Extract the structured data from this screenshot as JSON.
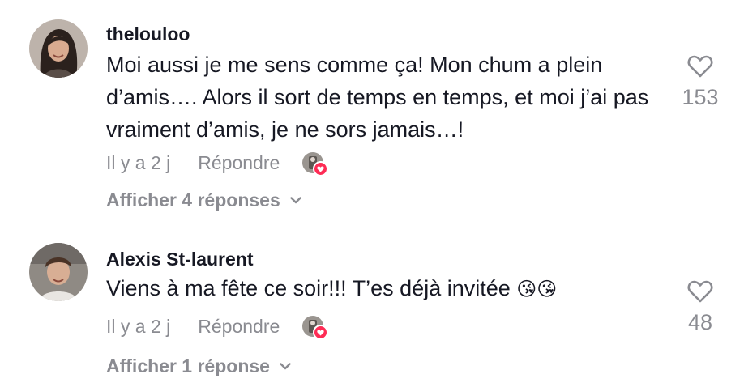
{
  "comments": [
    {
      "username": "thelouloo",
      "text": "Moi aussi je me sens comme ça! Mon chum a plein d’amis…. Alors il sort de temps en temps, et moi j’ai pas vraiment d’amis, je ne sors jamais…!",
      "timestamp": "Il y a 2 j",
      "reply_label": "Répondre",
      "like_count": "153",
      "view_replies": "Afficher 4 réponses",
      "avatar_icon": "avatar-woman-photo",
      "liked_by_author": true
    },
    {
      "username": "Alexis St-laurent",
      "text": "Viens à ma fête ce soir!!! T’es déjà invitée",
      "emoji": "😘😘",
      "timestamp": "Il y a 2 j",
      "reply_label": "Répondre",
      "like_count": "48",
      "view_replies": "Afficher 1 réponse",
      "avatar_icon": "avatar-man-photo",
      "liked_by_author": true
    }
  ],
  "colors": {
    "text_primary": "#161823",
    "text_secondary": "#8a8b91",
    "heart_badge": "#fe2c55"
  }
}
